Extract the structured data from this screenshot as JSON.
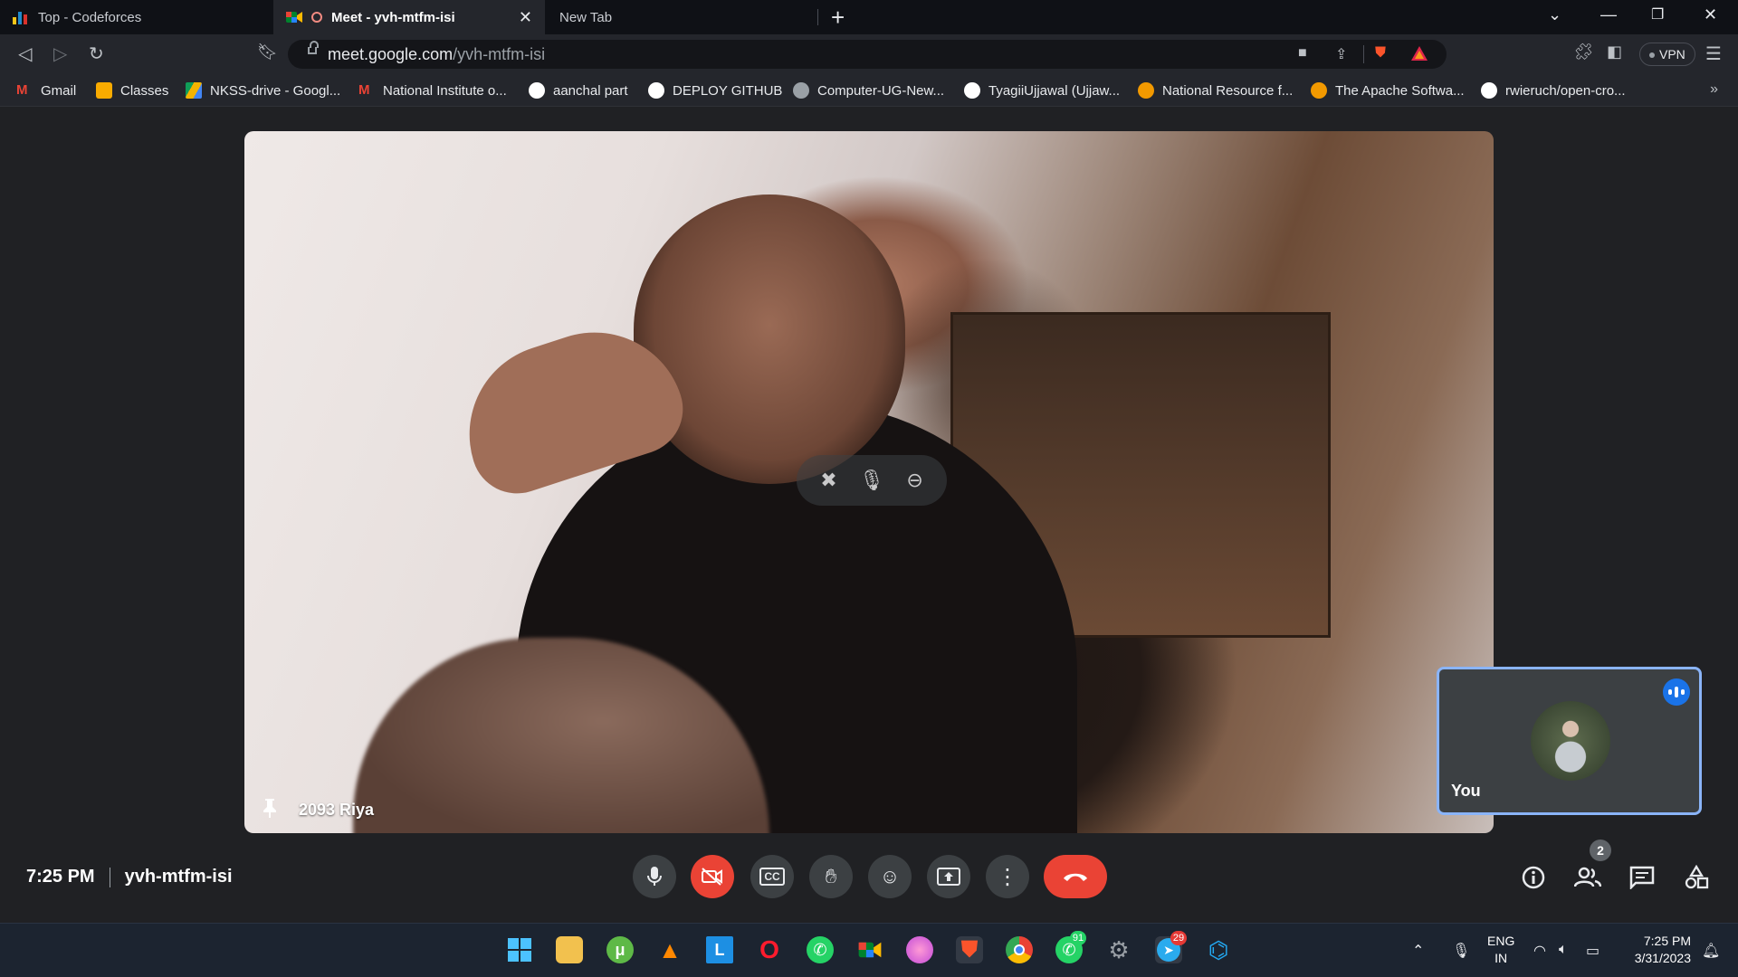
{
  "browser": {
    "tabs": [
      {
        "title": "Top - Codeforces",
        "active": false
      },
      {
        "title": "Meet - yvh-mtfm-isi",
        "active": true
      },
      {
        "title": "New Tab",
        "active": false
      }
    ],
    "url_domain": "meet.google.com",
    "url_path": "/yvh-mtfm-isi",
    "vpn_label": "VPN",
    "bookmarks": [
      {
        "label": "Gmail",
        "icon": "gmail-icon",
        "color": "#ea4335"
      },
      {
        "label": "Classes",
        "icon": "classroom-icon",
        "color": "#f9ab00"
      },
      {
        "label": "NKSS-drive - Googl...",
        "icon": "drive-icon",
        "color": "#34a853"
      },
      {
        "label": "National Institute o...",
        "icon": "gmail-icon",
        "color": "#ea4335"
      },
      {
        "label": "aanchal part",
        "icon": "github-icon",
        "color": "#ffffff"
      },
      {
        "label": "DEPLOY GITHUB",
        "icon": "github-icon",
        "color": "#ffffff"
      },
      {
        "label": "Computer-UG-New...",
        "icon": "globe-icon",
        "color": "#bdc1c6"
      },
      {
        "label": "TyagiiUjjawal (Ujjaw...",
        "icon": "github-icon",
        "color": "#ffffff"
      },
      {
        "label": "National Resource f...",
        "icon": "code-icon",
        "color": "#f29900"
      },
      {
        "label": "The Apache Softwa...",
        "icon": "code-icon",
        "color": "#f29900"
      },
      {
        "label": "rwieruch/open-cro...",
        "icon": "github-icon",
        "color": "#ffffff"
      }
    ]
  },
  "meet": {
    "participant_name": "2093 Riya",
    "self_label": "You",
    "time": "7:25 PM",
    "meeting_code": "yvh-mtfm-isi",
    "participants_count": "2",
    "accent_end_call": "#ea4335",
    "accent_self_border": "#8ab4f8"
  },
  "taskbar": {
    "language": "ENG",
    "region": "IN",
    "clock_time": "7:25 PM",
    "clock_date": "3/31/2023",
    "whatsapp_badge": "91",
    "telegram_badge": "29"
  }
}
